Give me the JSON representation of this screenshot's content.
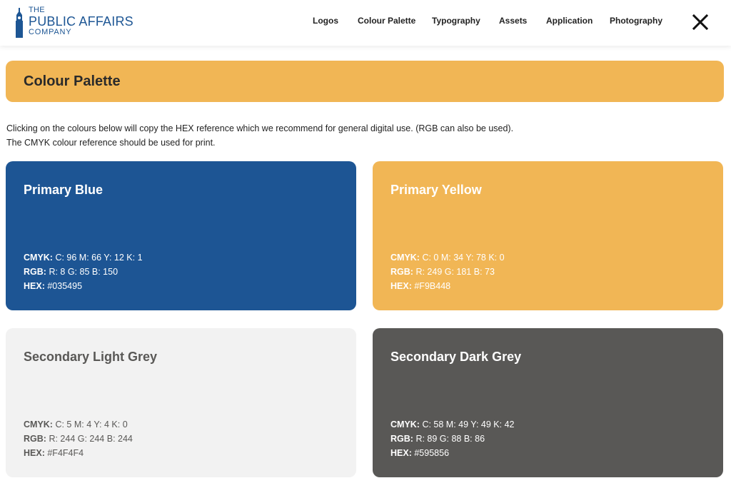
{
  "header": {
    "logo": {
      "line1": "THE",
      "line2": "PUBLIC AFFAIRS",
      "line3": "COMPANY"
    },
    "nav": [
      {
        "label": "Logos"
      },
      {
        "label": "Colour Palette"
      },
      {
        "label": "Typography"
      },
      {
        "label": "Assets"
      },
      {
        "label": "Application"
      },
      {
        "label": "Photography"
      }
    ],
    "close_icon": "close-icon"
  },
  "page": {
    "title": "Colour Palette",
    "intro_line1": "Clicking on the colours below will copy the HEX reference which we recommend for general digital use. (RGB can also be used).",
    "intro_line2": "The CMYK colour reference should be used for print."
  },
  "colors": [
    {
      "name": "Primary Blue",
      "cmyk_label": "CMYK:",
      "cmyk": "C: 96 M: 66 Y: 12 K: 1",
      "rgb_label": "RGB:",
      "rgb": "R: 8 G: 85 B: 150",
      "hex_label": "HEX:",
      "hex": "#035495",
      "swatch": "#1D5594"
    },
    {
      "name": "Primary Yellow",
      "cmyk_label": "CMYK:",
      "cmyk": "C: 0 M: 34 Y: 78 K: 0",
      "rgb_label": "RGB:",
      "rgb": "R: 249 G: 181 B: 73",
      "hex_label": "HEX:",
      "hex": "#F9B448",
      "swatch": "#F1B655"
    },
    {
      "name": "Secondary Light Grey",
      "cmyk_label": "CMYK:",
      "cmyk": "C: 5 M: 4 Y: 4 K: 0",
      "rgb_label": "RGB:",
      "rgb": "R: 244 G: 244 B: 244",
      "hex_label": "HEX:",
      "hex": "#F4F4F4",
      "swatch": "#F2F2F2"
    },
    {
      "name": "Secondary Dark Grey",
      "cmyk_label": "CMYK:",
      "cmyk": "C: 58 M: 49 Y: 49 K: 42",
      "rgb_label": "RGB:",
      "rgb": "R: 89 G: 88 B: 86",
      "hex_label": "HEX:",
      "hex": "#595856",
      "swatch": "#595856"
    }
  ],
  "theme": {
    "brand_blue": "#1D5694",
    "brand_yellow": "#F1B655"
  }
}
